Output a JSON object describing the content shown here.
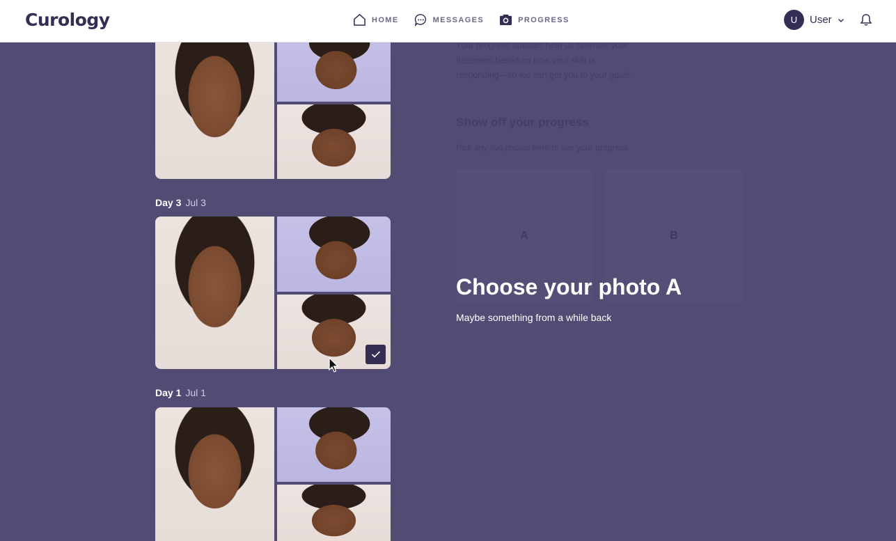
{
  "header": {
    "logo": "Curology",
    "nav": [
      {
        "label": "HOME",
        "icon": "home-icon"
      },
      {
        "label": "MESSAGES",
        "icon": "chat-icon"
      },
      {
        "label": "PROGRESS",
        "icon": "camera-icon"
      }
    ],
    "user": {
      "initial": "U",
      "name": "User"
    },
    "notifications_icon": "bell-icon"
  },
  "photo_sets": [
    {
      "day": "",
      "date": ""
    },
    {
      "day": "Day 3",
      "date": "Jul 3",
      "selected": true
    },
    {
      "day": "Day 1",
      "date": "Jul 1"
    }
  ],
  "background": {
    "intro": "Your progress updates help us optimize your treatment based on how your skin is responding—so we can get you to your goals.",
    "title": "Show off your progress",
    "subtitle": "Pick any two photos here to see your progress",
    "slot_a": "A",
    "slot_b": "B"
  },
  "prompt": {
    "title": "Choose your photo A",
    "subtitle": "Maybe something from a while back"
  },
  "colors": {
    "brand": "#332e54",
    "overlay": "#524c74",
    "nav_text": "#6b6888"
  }
}
